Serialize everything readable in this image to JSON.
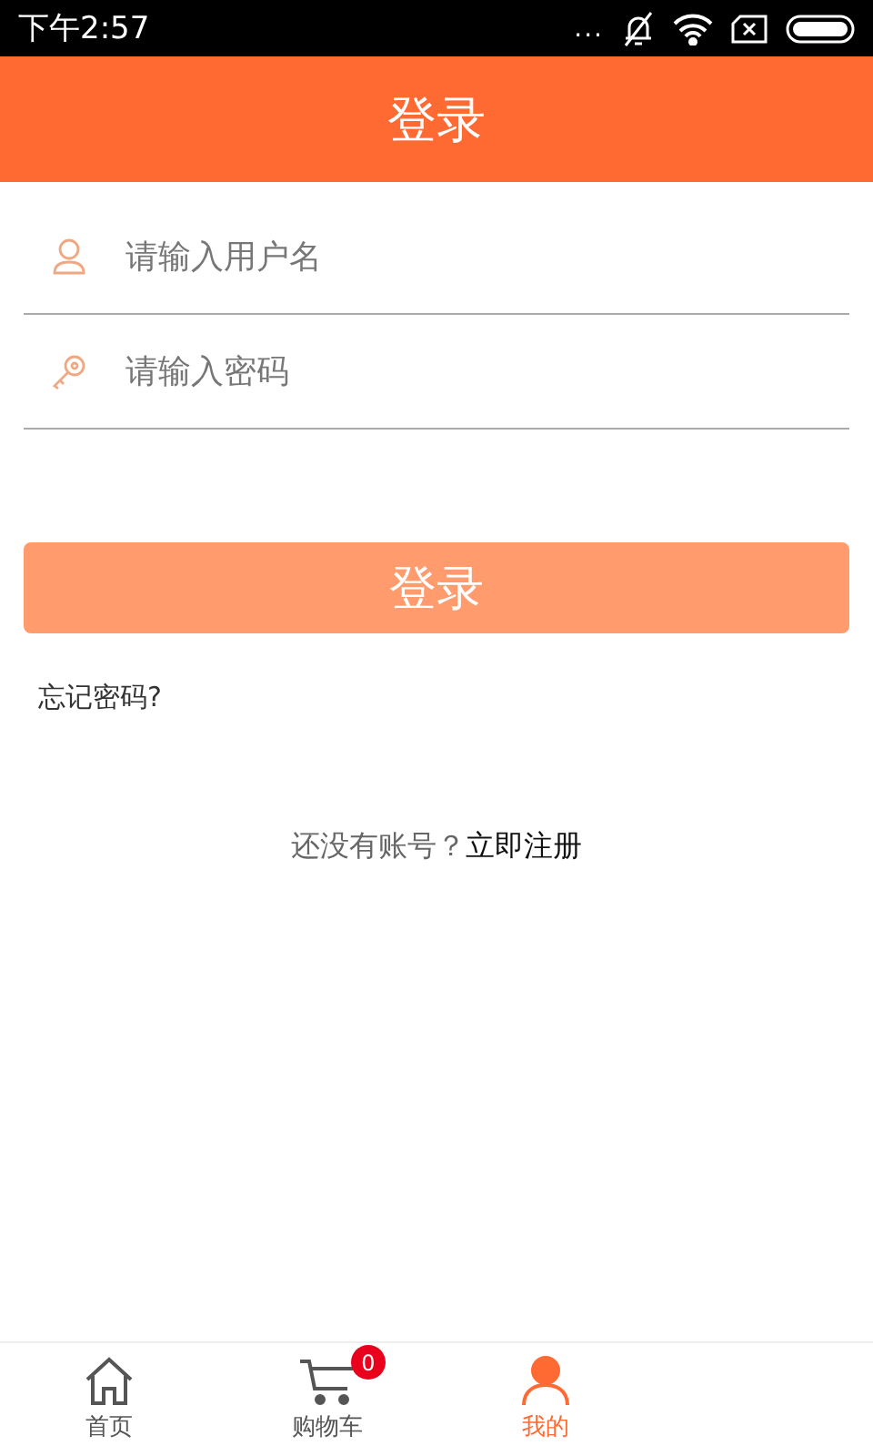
{
  "status_bar": {
    "time": "下午2:57",
    "more": "..."
  },
  "header": {
    "title": "登录"
  },
  "fields": [
    {
      "kind": "user",
      "placeholder": "请输入用户名"
    },
    {
      "kind": "password",
      "placeholder": "请输入密码"
    }
  ],
  "login_button": "登录",
  "forgot_link": "忘记密码?",
  "register": {
    "prompt": "还没有账号？",
    "link": "立即注册"
  },
  "tabs": [
    {
      "kind": "home",
      "label": "首页",
      "selected": false
    },
    {
      "kind": "cart",
      "label": "购物车",
      "selected": false,
      "badge": "0"
    },
    {
      "kind": "me",
      "label": "我的",
      "selected": true
    }
  ]
}
